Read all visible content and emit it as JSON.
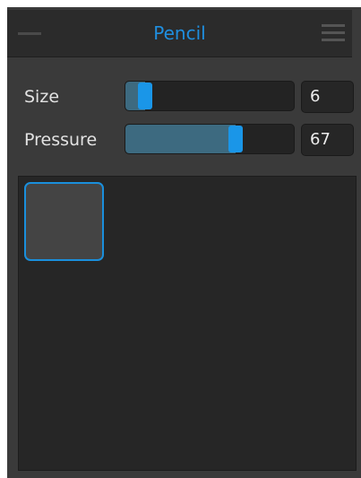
{
  "panel": {
    "title": "Pencil",
    "accent_color": "#1a96e8",
    "collapse_icon": "minus-icon",
    "menu_icon": "hamburger-menu-icon"
  },
  "settings": [
    {
      "label": "Size",
      "value": "6",
      "fraction": 0.08
    },
    {
      "label": "Pressure",
      "value": "67",
      "fraction": 0.67
    }
  ],
  "brushes": [
    {
      "color": "#444444",
      "selected": true
    }
  ]
}
